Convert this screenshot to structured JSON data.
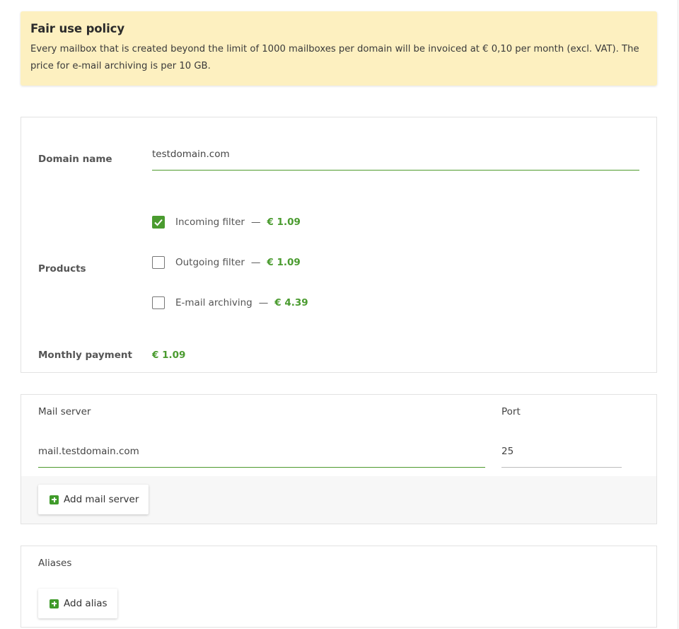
{
  "notice": {
    "title": "Fair use policy",
    "text": "Every mailbox that is created beyond the limit of 1000 mailboxes per domain will be invoiced at € 0,10 per month (excl. VAT). The price for e-mail archiving is per 10 GB."
  },
  "domain": {
    "label": "Domain name",
    "value": "testdomain.com"
  },
  "products": {
    "label": "Products",
    "items": [
      {
        "name": "Incoming filter",
        "price": "€ 1.09",
        "checked": true
      },
      {
        "name": "Outgoing filter",
        "price": "€ 1.09",
        "checked": false
      },
      {
        "name": "E-mail archiving",
        "price": "€ 4.39",
        "checked": false
      }
    ],
    "separator": "—"
  },
  "payment": {
    "label": "Monthly payment",
    "value": "€ 1.09"
  },
  "mail": {
    "server_label": "Mail server",
    "port_label": "Port",
    "server_value": "mail.testdomain.com",
    "port_value": "25",
    "add_label": "Add mail server"
  },
  "aliases": {
    "label": "Aliases",
    "add_label": "Add alias"
  },
  "colors": {
    "accent": "#4a9b2f",
    "notice_bg": "#fdf0c0"
  }
}
